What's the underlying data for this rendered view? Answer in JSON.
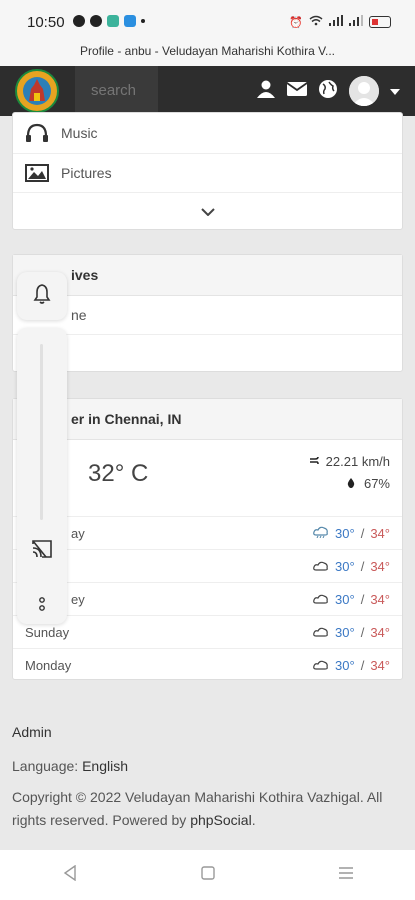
{
  "status_bar": {
    "time": "10:50",
    "battery_level_percent": 35
  },
  "browser": {
    "page_title": "Profile - anbu - Veludayan Maharishi Kothira V..."
  },
  "navbar": {
    "search_placeholder": "search"
  },
  "media_menu": {
    "items": [
      {
        "label": "Music",
        "icon": "headphones-icon"
      },
      {
        "label": "Pictures",
        "icon": "image-icon"
      }
    ]
  },
  "archives": {
    "title_visible": "ives",
    "item_visible": "ne"
  },
  "weather": {
    "title_visible": "er in Chennai, IN",
    "temperature": "32° C",
    "wind": "22.21 km/h",
    "humidity": "67%",
    "forecast": [
      {
        "day": "ay",
        "low": "30°",
        "high": "34°",
        "icon": "rain-cloud-icon"
      },
      {
        "day": "",
        "low": "30°",
        "high": "34°",
        "icon": "cloud-icon"
      },
      {
        "day": "ey",
        "low": "30°",
        "high": "34°",
        "icon": "cloud-icon"
      },
      {
        "day": "Sunday",
        "low": "30°",
        "high": "34°",
        "icon": "cloud-icon"
      },
      {
        "day": "Monday",
        "low": "30°",
        "high": "34°",
        "icon": "cloud-icon"
      }
    ]
  },
  "footer": {
    "admin_label": "Admin",
    "language_label": "Language:",
    "language_value": "English",
    "copyright": "Copyright © 2022 Veludayan Maharishi Kothira Vazhigal. All rights reserved. Powered by",
    "powered_link": "phpSocial",
    "period": "."
  },
  "colors": {
    "navbar_bg": "#2d2d2d",
    "temp_low": "#3b78c4",
    "temp_high": "#c95a5a"
  }
}
